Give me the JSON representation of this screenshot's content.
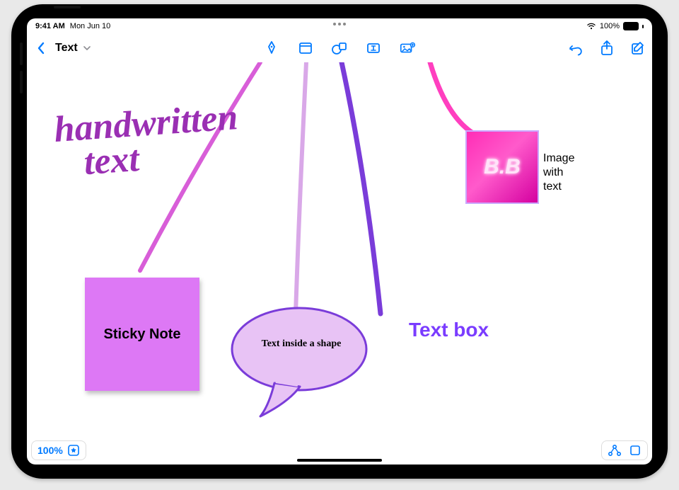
{
  "statusbar": {
    "time": "9:41 AM",
    "date": "Mon Jun 10",
    "battery": "100%"
  },
  "toolbar": {
    "title": "Text",
    "tools": {
      "pen": "pen-tool",
      "sticky": "sticky-note-tool",
      "shape": "shape-tool",
      "textbox": "text-box-tool",
      "media": "media-tool"
    },
    "right": {
      "undo": "undo",
      "share": "share",
      "edit": "edit"
    }
  },
  "canvas": {
    "handwritten_line1": "handwritten",
    "handwritten_line2": "text",
    "sticky": "Sticky Note",
    "bubble": "Text inside a shape",
    "textbox": "Text box",
    "image_caption": "B.B",
    "image_label_line1": "Image",
    "image_label_line2": "with",
    "image_label_line3": "text"
  },
  "footer": {
    "zoom": "100%"
  }
}
